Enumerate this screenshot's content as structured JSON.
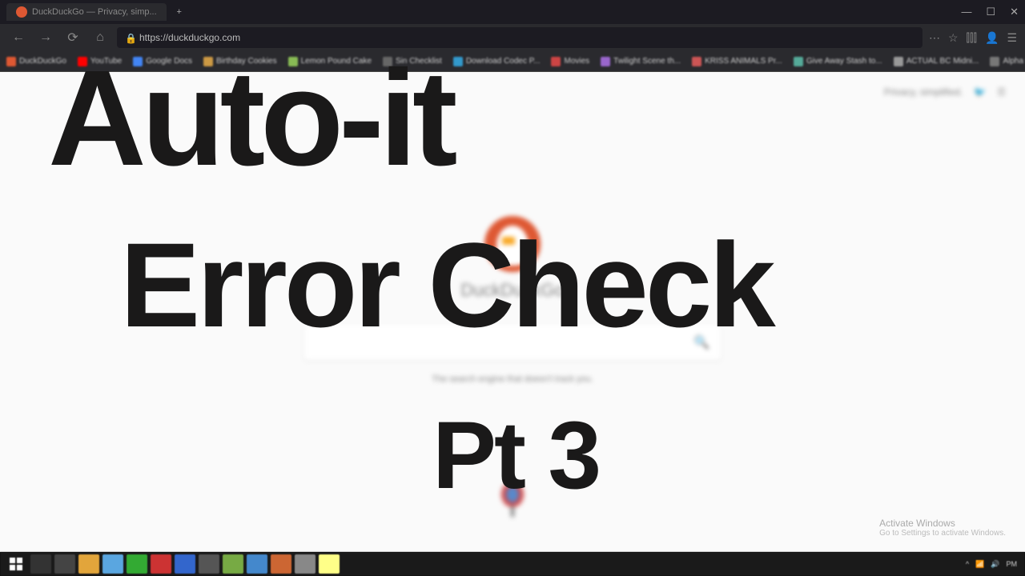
{
  "browser": {
    "tab_title": "DuckDuckGo — Privacy, simp...",
    "url": "https://duckduckgo.com",
    "privacy_text": "Privacy, simplified."
  },
  "search_engine": {
    "name": "DuckDuckGo",
    "tagline": "The search engine that doesn't track you."
  },
  "overlay": {
    "line1": "Auto-it",
    "line2": "Error Check",
    "line3": "Pt 3"
  },
  "windows": {
    "activate_title": "Activate Windows",
    "activate_sub": "Go to Settings to activate Windows."
  },
  "bookmarks": [
    "DuckDuckGo",
    "YouTube",
    "Google Docs",
    "Birthday Cookies",
    "Lemon Pound Cake",
    "Sin Checklist",
    "Download Codec P...",
    "Movies",
    "Twilight Scene th...",
    "KRISS ANIMALS Pr...",
    "Give Away Stash to...",
    "ACTUAL BC Midni...",
    "Alpha Codes - some..."
  ],
  "bookmark_colors": [
    "#de5833",
    "#f00",
    "#4285f4",
    "#c94",
    "#8b5",
    "#666",
    "#39c",
    "#c44",
    "#96c",
    "#c55",
    "#5a9",
    "#999",
    "#777"
  ]
}
